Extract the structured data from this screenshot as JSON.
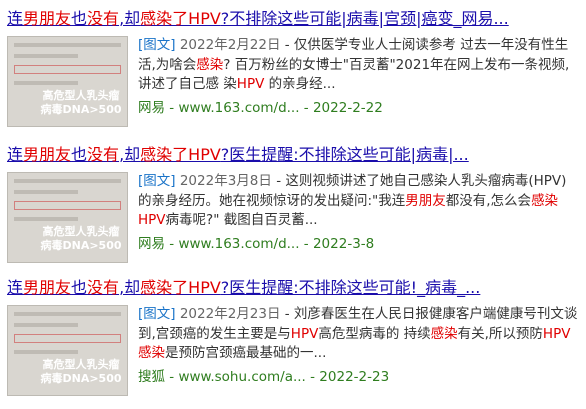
{
  "results": [
    {
      "title_parts": [
        "连",
        "男朋友",
        "也",
        "没有",
        ",却",
        "感染了HPV",
        "?不排除这些可能|病毒|宫颈|癌变_网易..."
      ],
      "tag": "[图文]",
      "date": "2022年2月22日",
      "snippet_parts": [
        "- 仅供医学专业人士阅读参考 过去一年没有性生活,为啥会",
        "感染",
        "? 百万粉丝的女博士\"百灵蓄\"2021年在网上发布一条视频,讲述了自己感 染",
        "HPV",
        " 的亲身经..."
      ],
      "source": "网易 - www.163.com/d... - 2022-2-22",
      "thumb_stamp": [
        "高危型人乳头瘤",
        "病毒DNA>500"
      ]
    },
    {
      "title_parts": [
        "连",
        "男朋友",
        "也",
        "没有",
        ",却",
        "感染了HPV",
        "?医生提醒:不排除这些可能|病毒|..."
      ],
      "tag": "[图文]",
      "date": "2022年3月8日",
      "snippet_parts": [
        "- 这则视频讲述了她自己感染人乳头瘤病毒(HPV)的亲身经历。她在视频惊讶的发出疑问:\"我连",
        "男朋友",
        "都没有,怎么会",
        "感染",
        "HPV",
        "病毒呢?\" 截图自百灵蓄..."
      ],
      "source": "网易 - www.163.com/d... - 2022-3-8",
      "thumb_stamp": [
        "高危型人乳头瘤",
        "病毒DNA>500"
      ]
    },
    {
      "title_parts": [
        "连",
        "男朋友",
        "也",
        "没有",
        ",却",
        "感染了HPV",
        "?医生提醒:不排除这些可能!_病毒_..."
      ],
      "tag": "[图文]",
      "date": "2022年2月23日",
      "snippet_parts": [
        "- 刘彦春医生在人民日报健康客户端健康号刊文谈到,宫颈癌的发生主要是与",
        "HPV",
        "高危型病毒的 持续",
        "感染",
        "有关,所以预防",
        "HPV感染",
        "是预防宫颈癌最基础的一..."
      ],
      "source": "搜狐 - www.sohu.com/a... - 2022-2-23",
      "thumb_stamp": [
        "高危型人乳头瘤",
        "病毒DNA>500"
      ]
    }
  ]
}
